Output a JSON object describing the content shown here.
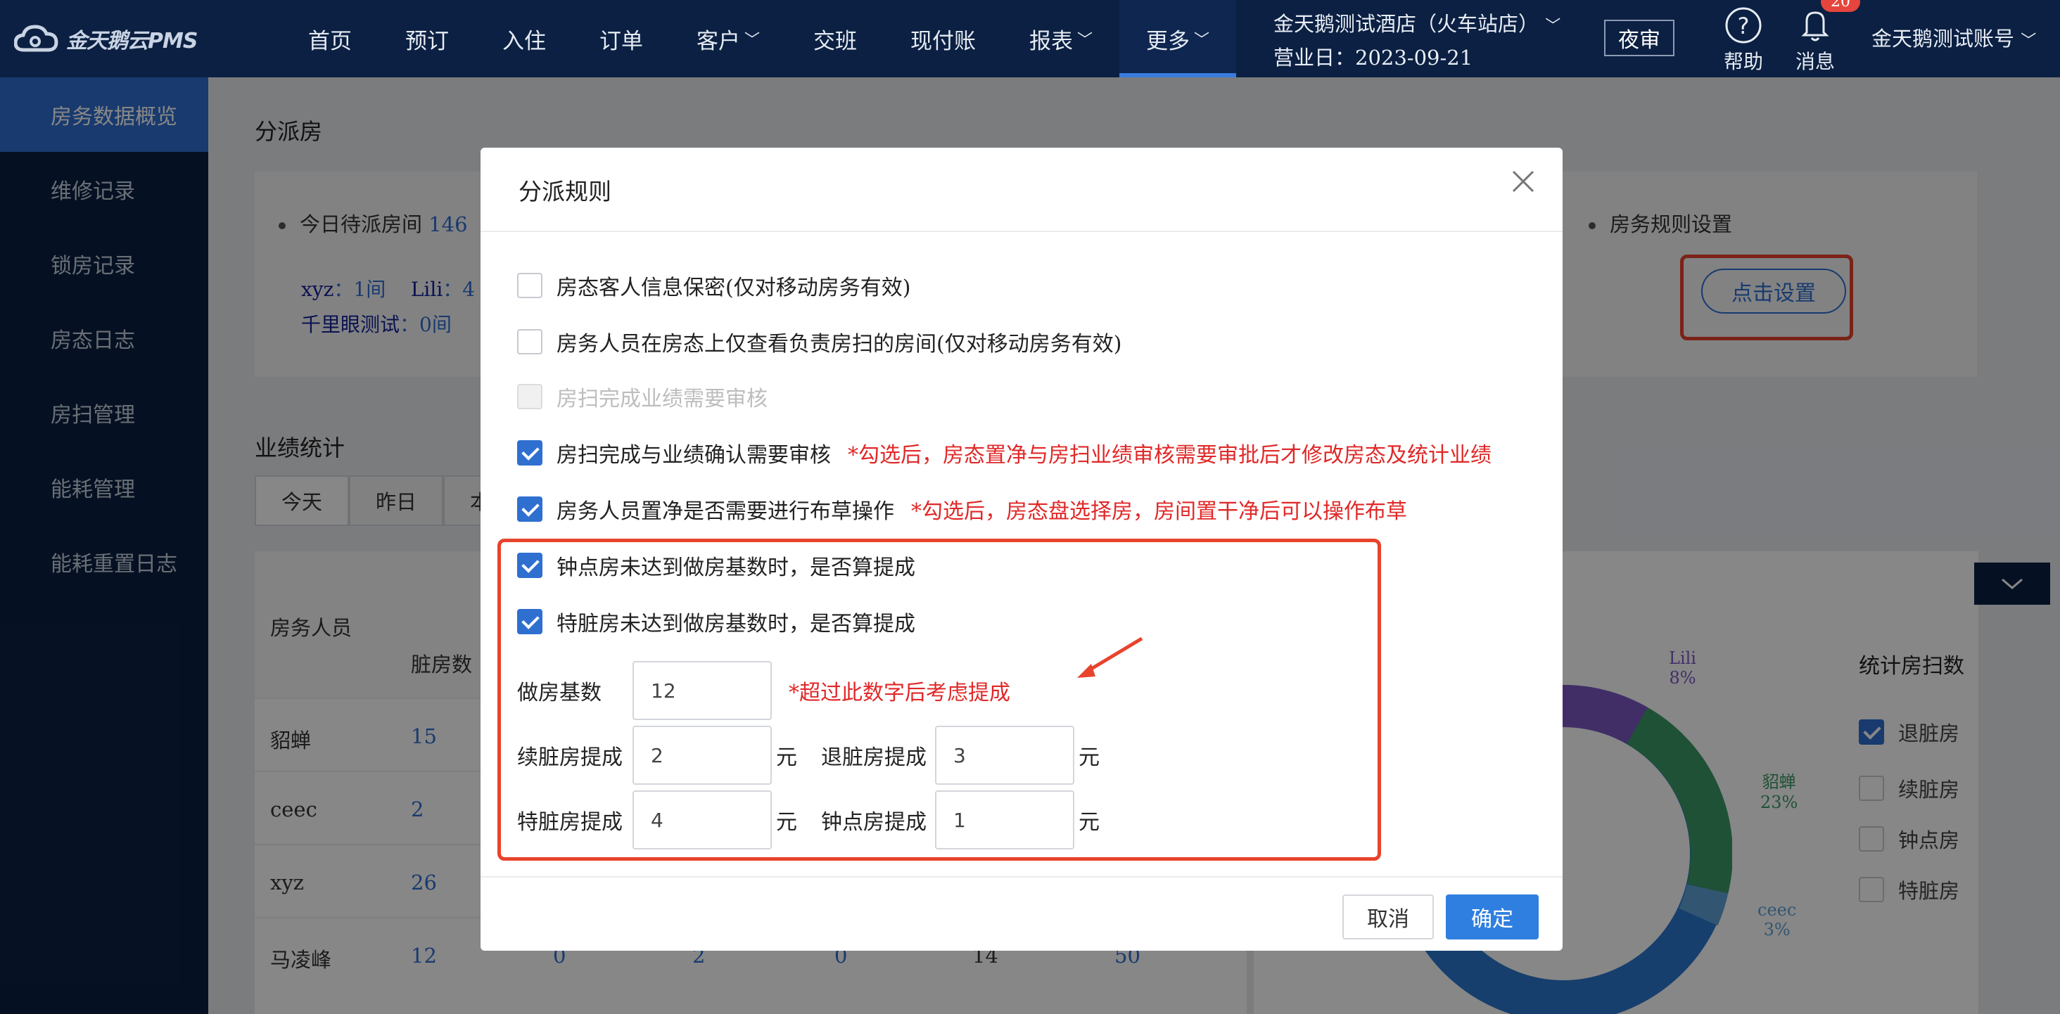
{
  "topbar": {
    "logo_text": "金天鹅云PMS",
    "nav": [
      {
        "label": "首页"
      },
      {
        "label": "预订"
      },
      {
        "label": "入住"
      },
      {
        "label": "订单"
      },
      {
        "label": "客户",
        "chevron": true
      },
      {
        "label": "交班"
      },
      {
        "label": "现付账"
      },
      {
        "label": "报表",
        "chevron": true
      },
      {
        "label": "更多",
        "chevron": true
      }
    ],
    "hotel_name": "金天鹅测试酒店（火车站店）",
    "business_day": "营业日：2023-09-21",
    "night_audit": "夜审",
    "help_label": "帮助",
    "message_label": "消息",
    "message_count": "20",
    "account": "金天鹅测试账号"
  },
  "sidebar": {
    "items": [
      {
        "label": "房务数据概览",
        "active": true
      },
      {
        "label": "维修记录"
      },
      {
        "label": "锁房记录"
      },
      {
        "label": "房态日志"
      },
      {
        "label": "房扫管理"
      },
      {
        "label": "能耗管理"
      },
      {
        "label": "能耗重置日志"
      }
    ]
  },
  "background": {
    "assign_title": "分派房",
    "pending_prefix": "今日待派房间",
    "pending_count": "146",
    "staff_line1_name1": "xyz",
    "staff_line1_val1": "：1间",
    "staff_line1_name2": "Lili",
    "staff_line1_val2": "：4",
    "staff_line2_name": "千里眼测试",
    "staff_line2_val": "：0间",
    "rules_label": "房务规则设置",
    "set_button": "点击设置",
    "perf_title": "业绩统计",
    "tabs": [
      "今天",
      "昨日",
      "本"
    ],
    "table_headers": {
      "staff": "房务人员",
      "dirty": "脏房数"
    },
    "rows": [
      {
        "name": "貂蝉",
        "v1": "15"
      },
      {
        "name": "ceec",
        "v1": "2"
      },
      {
        "name": "xyz",
        "v1": "26"
      },
      {
        "name": "马凌峰",
        "v1": "12",
        "v2": "0",
        "v3": "2",
        "v4": "0",
        "v5": "14",
        "v6": "50"
      }
    ],
    "chart_title": "统计房扫数",
    "chart_labels": {
      "lili": "Lili",
      "lili_pct": "8%",
      "diaochan": "貂蝉",
      "diaochan_pct": "23%",
      "ceec": "ceec",
      "ceec_pct": "3%"
    },
    "legend": [
      {
        "label": "退脏房",
        "checked": true
      },
      {
        "label": "续脏房"
      },
      {
        "label": "钟点房"
      },
      {
        "label": "特脏房"
      }
    ]
  },
  "modal": {
    "title": "分派规则",
    "options": [
      {
        "label": "房态客人信息保密(仅对移动房务有效)",
        "checked": false
      },
      {
        "label": "房务人员在房态上仅查看负责房扫的房间(仅对移动房务有效)",
        "checked": false
      },
      {
        "label": "房扫完成业绩需要审核",
        "checked": false,
        "disabled": true
      },
      {
        "label": "房扫完成与业绩确认需要审核",
        "checked": true,
        "note": "*勾选后，房态置净与房扫业绩审核需要审批后才修改房态及统计业绩"
      },
      {
        "label": "房务人员置净是否需要进行布草操作",
        "checked": true,
        "note": "*勾选后，房态盘选择房，房间置干净后可以操作布草"
      },
      {
        "label": "钟点房未达到做房基数时，是否算提成",
        "checked": true
      },
      {
        "label": "特脏房未达到做房基数时，是否算提成",
        "checked": true
      }
    ],
    "base_label": "做房基数",
    "base_value": "12",
    "base_note": "*超过此数字后考虑提成",
    "continue_dirty_label": "续脏房提成",
    "continue_dirty_value": "2",
    "checkout_dirty_label": "退脏房提成",
    "checkout_dirty_value": "3",
    "special_dirty_label": "特脏房提成",
    "special_dirty_value": "4",
    "hourly_label": "钟点房提成",
    "hourly_value": "1",
    "unit": "元",
    "cancel": "取消",
    "confirm": "确定"
  },
  "colors": {
    "topbar_bg": "#0b2042",
    "accent": "#2f6fd0",
    "highlight_red": "#e8432c",
    "note_red": "#e02828"
  }
}
